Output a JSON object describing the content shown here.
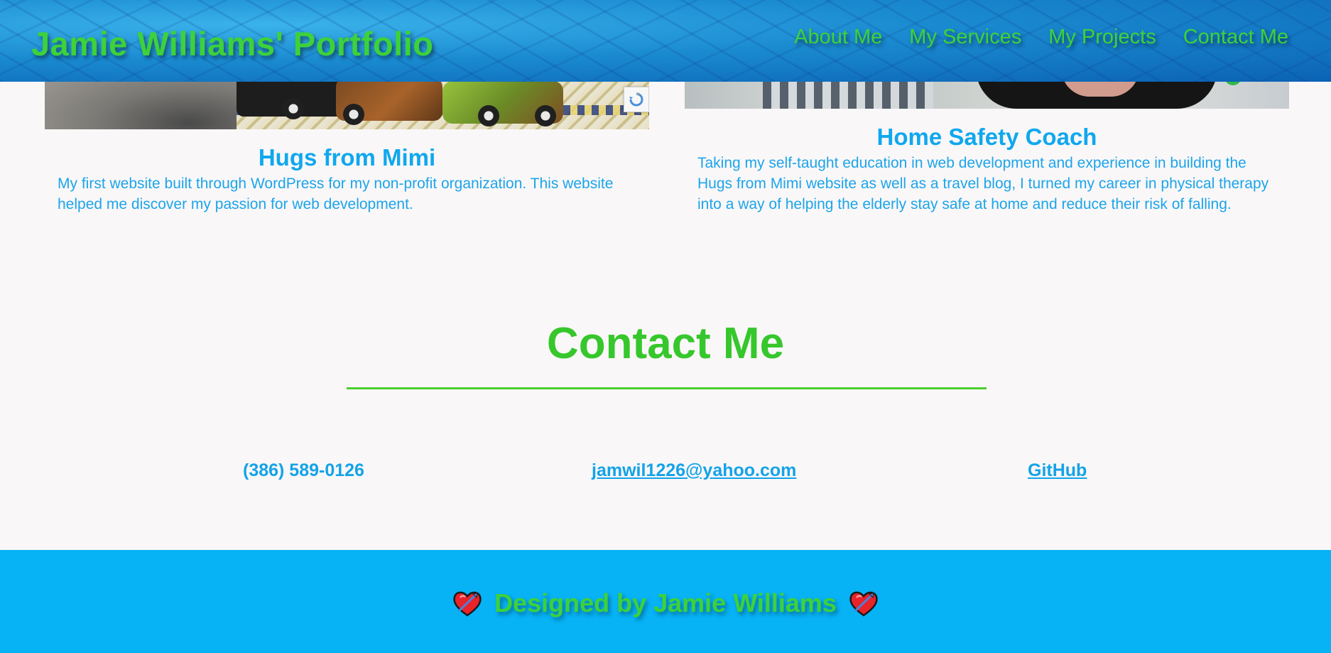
{
  "header": {
    "title": "Jamie Williams' Portfolio",
    "nav": [
      {
        "label": "About Me"
      },
      {
        "label": "My Services"
      },
      {
        "label": "My Projects"
      },
      {
        "label": "Contact Me"
      }
    ]
  },
  "projects": [
    {
      "title": "Hugs from Mimi",
      "description": "My first website built through WordPress for my non-profit organization. This website helped me discover my passion for web development."
    },
    {
      "title": "Home Safety Coach",
      "description": "Taking my self-taught education in web development and experience in building the Hugs from Mimi website as well as a travel blog, I turned my career in physical therapy into a way of helping the elderly stay safe at home and reduce their risk of falling."
    }
  ],
  "contact": {
    "heading": "Contact Me",
    "phone": "(386) 589-0126",
    "email": "jamwil1226@yahoo.com",
    "github": "GitHub"
  },
  "footer": {
    "text": "Designed by Jamie Williams",
    "icon": "heart-with-arrow-icon"
  },
  "colors": {
    "accent_green": "#3dd23a",
    "accent_blue": "#0fa8ee",
    "footer_bg": "#07b2f5",
    "page_bg": "#faf7f8"
  }
}
